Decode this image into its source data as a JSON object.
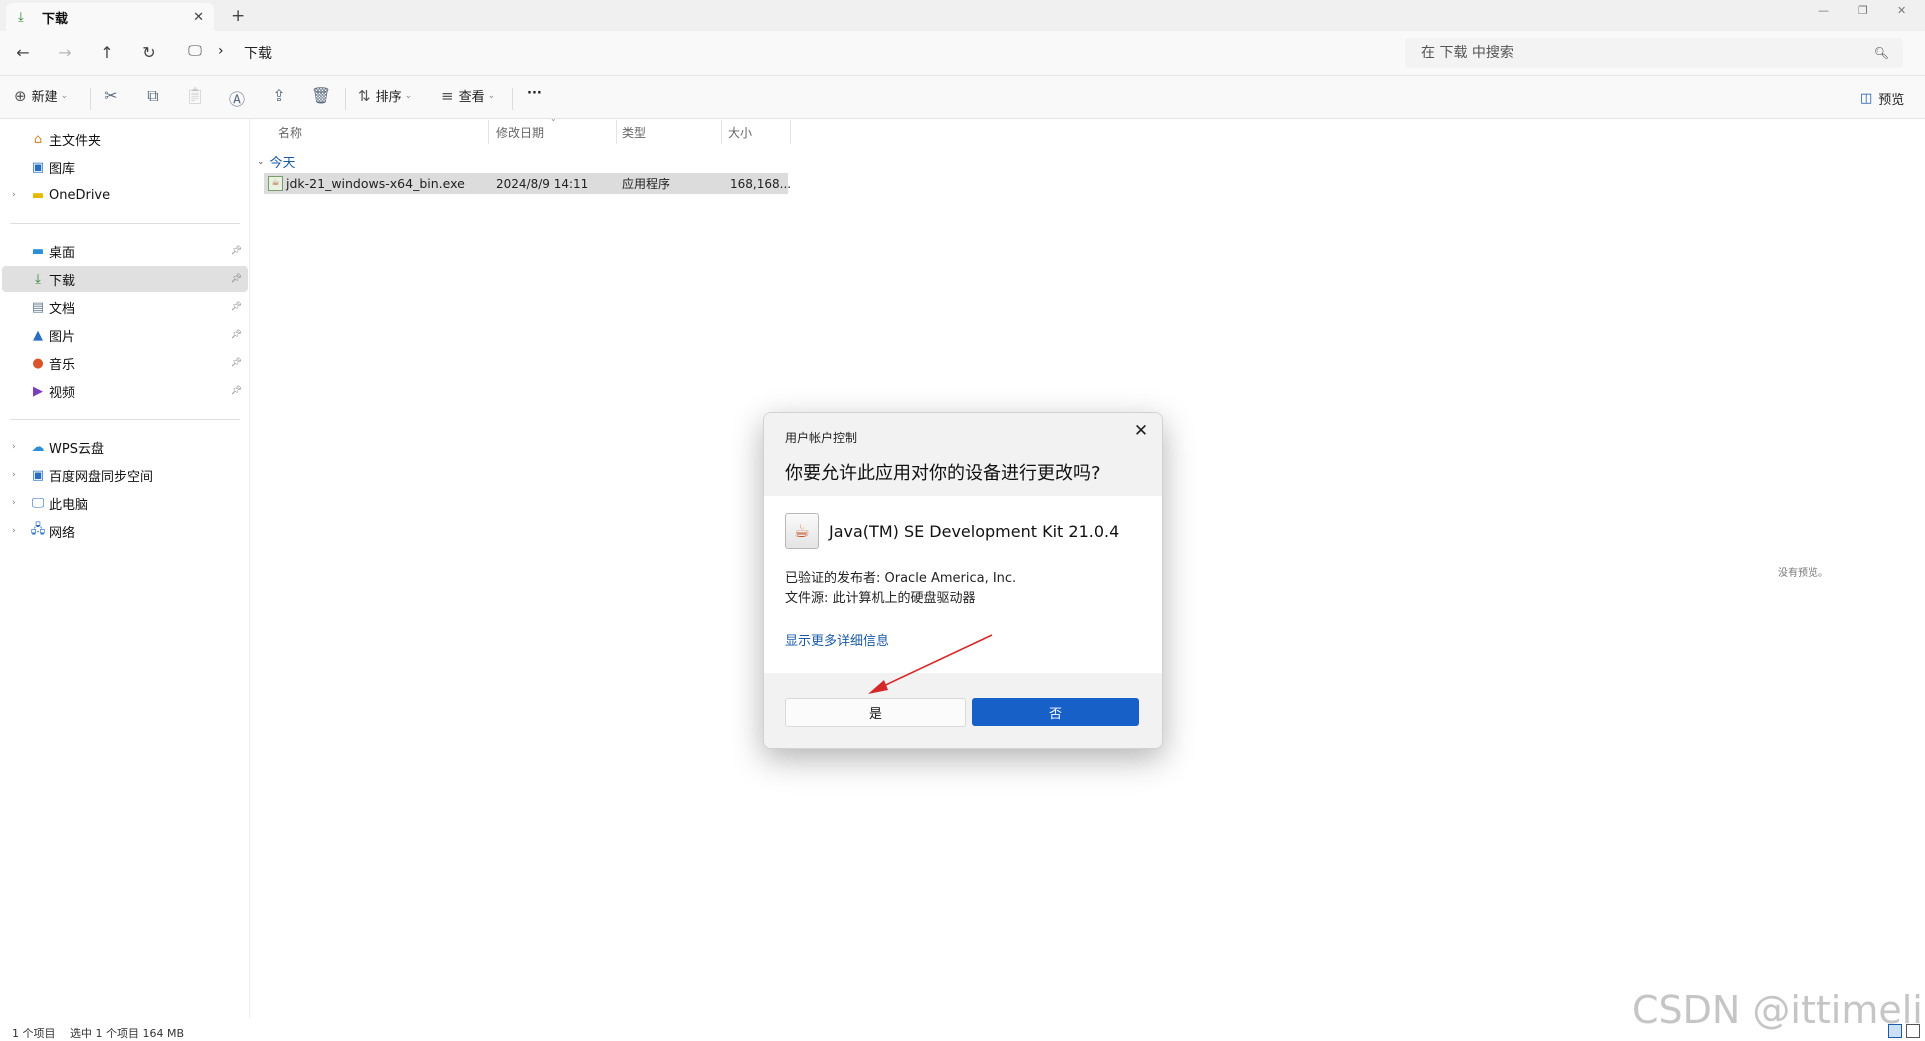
{
  "window": {
    "tab_label": "下载",
    "tab_icon": "download-icon",
    "tab_close": "✕",
    "new_tab": "+"
  },
  "address": {
    "breadcrumb_separator": "›",
    "current_folder": "下载",
    "search_placeholder": "在 下载 中搜索"
  },
  "toolbar": {
    "new_label": "新建",
    "sort_label": "排序",
    "view_label": "查看",
    "more_label": "···",
    "preview_label": "预览"
  },
  "sidebar": {
    "items": [
      {
        "label": "主文件夹",
        "icon": "home-icon"
      },
      {
        "label": "图库",
        "icon": "gallery-icon"
      },
      {
        "label": "OneDrive",
        "icon": "folder-icon"
      },
      {
        "label": "桌面",
        "icon": "desktop-icon"
      },
      {
        "label": "下载",
        "icon": "download-icon"
      },
      {
        "label": "文档",
        "icon": "document-icon"
      },
      {
        "label": "图片",
        "icon": "pictures-icon"
      },
      {
        "label": "音乐",
        "icon": "music-icon"
      },
      {
        "label": "视频",
        "icon": "video-icon"
      },
      {
        "label": "WPS云盘",
        "icon": "cloud-icon"
      },
      {
        "label": "百度网盘同步空间",
        "icon": "baidu-drive-icon"
      },
      {
        "label": "此电脑",
        "icon": "computer-icon"
      },
      {
        "label": "网络",
        "icon": "network-icon"
      }
    ]
  },
  "filelist": {
    "columns": [
      "名称",
      "修改日期",
      "类型",
      "大小"
    ],
    "group_label": "今天",
    "files": [
      {
        "name": "jdk-21_windows-x64_bin.exe",
        "modified": "2024/8/9 14:11",
        "type": "应用程序",
        "size": "168,168..."
      }
    ],
    "no_preview": "没有预览。"
  },
  "status": {
    "item_count": "1 个项目",
    "selection": "选中 1 个项目  164 MB"
  },
  "watermark": "CSDN @ittimeline",
  "uac_dialog": {
    "title": "用户帐户控制",
    "question": "你要允许此应用对你的设备进行更改吗?",
    "app_name": "Java(TM) SE Development Kit 21.0.4",
    "publisher": "已验证的发布者: Oracle America, Inc.",
    "file_origin": "文件源: 此计算机上的硬盘驱动器",
    "details_link": "显示更多详细信息",
    "yes_label": "是",
    "no_label": "否"
  },
  "colors": {
    "accent": "#1660c8",
    "annotation_arrow": "#d62828"
  }
}
